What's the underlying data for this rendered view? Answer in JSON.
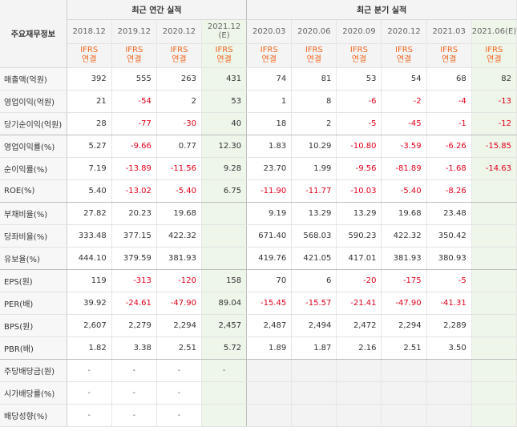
{
  "header": {
    "label": "주요재무정보",
    "annual_title": "최근 연간 실적",
    "quarter_title": "최근 분기 실적",
    "periods": [
      {
        "label": "2018.12",
        "sub": "",
        "est": false
      },
      {
        "label": "2019.12",
        "sub": "",
        "est": false
      },
      {
        "label": "2020.12",
        "sub": "",
        "est": false
      },
      {
        "label": "2021.12",
        "sub": "(E)",
        "est": true
      },
      {
        "label": "2020.03",
        "sub": "",
        "est": false
      },
      {
        "label": "2020.06",
        "sub": "",
        "est": false
      },
      {
        "label": "2020.09",
        "sub": "",
        "est": false
      },
      {
        "label": "2020.12",
        "sub": "",
        "est": false
      },
      {
        "label": "2021.03",
        "sub": "",
        "est": false
      },
      {
        "label": "2021.06",
        "sub": "(E)",
        "est": true
      }
    ],
    "ifrs_top": "IFRS",
    "ifrs_bottom": "연결"
  },
  "rows": [
    {
      "label": "매출액(억원)",
      "values": [
        "392",
        "555",
        "263",
        "431",
        "74",
        "81",
        "53",
        "54",
        "68",
        "82"
      ]
    },
    {
      "label": "영업이익(억원)",
      "values": [
        "21",
        "-54",
        "2",
        "53",
        "1",
        "8",
        "-6",
        "-2",
        "-4",
        "-13"
      ]
    },
    {
      "label": "당기순이익(억원)",
      "values": [
        "28",
        "-77",
        "-30",
        "40",
        "18",
        "2",
        "-5",
        "-45",
        "-1",
        "-12"
      ],
      "group_end": true
    },
    {
      "label": "영업이익률(%)",
      "values": [
        "5.27",
        "-9.66",
        "0.77",
        "12.30",
        "1.83",
        "10.29",
        "-10.80",
        "-3.59",
        "-6.26",
        "-15.85"
      ]
    },
    {
      "label": "순이익률(%)",
      "values": [
        "7.19",
        "-13.89",
        "-11.56",
        "9.28",
        "23.70",
        "1.99",
        "-9.56",
        "-81.89",
        "-1.68",
        "-14.63"
      ]
    },
    {
      "label": "ROE(%)",
      "values": [
        "5.40",
        "-13.02",
        "-5.40",
        "6.75",
        "-11.90",
        "-11.77",
        "-10.03",
        "-5.40",
        "-8.26",
        ""
      ],
      "group_end": true
    },
    {
      "label": "부채비율(%)",
      "values": [
        "27.82",
        "20.23",
        "19.68",
        "",
        "9.19",
        "13.29",
        "13.29",
        "19.68",
        "23.48",
        ""
      ]
    },
    {
      "label": "당좌비율(%)",
      "values": [
        "333.48",
        "377.15",
        "422.32",
        "",
        "671.40",
        "568.03",
        "590.23",
        "422.32",
        "350.42",
        ""
      ]
    },
    {
      "label": "유보율(%)",
      "values": [
        "444.10",
        "379.59",
        "381.93",
        "",
        "419.76",
        "421.05",
        "417.01",
        "381.93",
        "380.93",
        ""
      ],
      "group_end": true
    },
    {
      "label": "EPS(원)",
      "values": [
        "119",
        "-313",
        "-120",
        "158",
        "70",
        "6",
        "-20",
        "-175",
        "-5",
        ""
      ]
    },
    {
      "label": "PER(배)",
      "values": [
        "39.92",
        "-24.61",
        "-47.90",
        "89.04",
        "-15.45",
        "-15.57",
        "-21.41",
        "-47.90",
        "-41.31",
        ""
      ]
    },
    {
      "label": "BPS(원)",
      "values": [
        "2,607",
        "2,279",
        "2,294",
        "2,457",
        "2,487",
        "2,494",
        "2,472",
        "2,294",
        "2,289",
        ""
      ]
    },
    {
      "label": "PBR(배)",
      "values": [
        "1.82",
        "3.38",
        "2.51",
        "5.72",
        "1.89",
        "1.87",
        "2.16",
        "2.51",
        "3.50",
        ""
      ],
      "group_end": true
    },
    {
      "label": "주당배당금(원)",
      "values": [
        "-",
        "-",
        "-",
        "-",
        "",
        "",
        "",
        "",
        "",
        ""
      ]
    },
    {
      "label": "시가배당률(%)",
      "values": [
        "-",
        "-",
        "-",
        "",
        "",
        "",
        "",
        "",
        "",
        ""
      ]
    },
    {
      "label": "배당성향(%)",
      "values": [
        "-",
        "-",
        "-",
        "",
        "",
        "",
        "",
        "",
        "",
        ""
      ]
    }
  ]
}
